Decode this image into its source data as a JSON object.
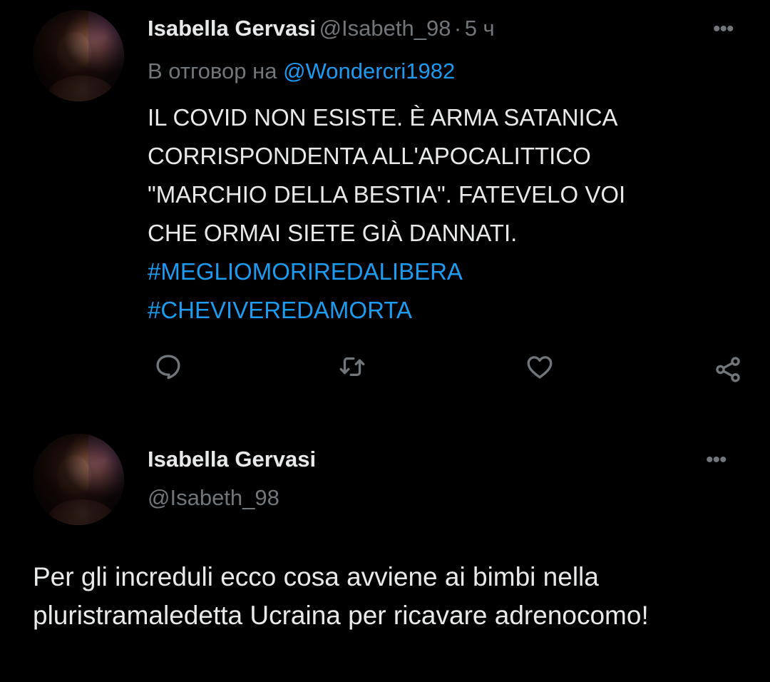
{
  "tweet1": {
    "author_name": "Isabella Gervasi",
    "author_handle": "@Isabeth_98",
    "separator": "·",
    "time": "5 ч",
    "reply_prefix": "В отговор на",
    "reply_handle": "@Wondercri1982",
    "text": "IL COVID NON ESISTE. È ARMA SATANICA\nCORRISPONDENTA ALL'APOCALITTICO\n\"MARCHIO DELLA BESTIA\". FATEVELO VOI\nCHE ORMAI SIETE GIÀ DANNATI.",
    "hashtags": [
      "#MEGLIOMORIREDALIBERA",
      "#CHEVIVEREDAMORTA"
    ],
    "more_label": "•••",
    "actions": [
      "reply-icon",
      "retweet-icon",
      "like-icon",
      "share-icon"
    ]
  },
  "tweet2": {
    "author_name": "Isabella Gervasi",
    "author_handle": "@Isabeth_98",
    "more_label": "•••",
    "text": "Per gli increduli ecco cosa avviene ai bimbi nella pluristramaledetta Ucraina per ricavare adrenocomo!"
  },
  "colors": {
    "background": "#000000",
    "text": "#e7e9ea",
    "muted": "#71767b",
    "link": "#1d9bf0"
  }
}
